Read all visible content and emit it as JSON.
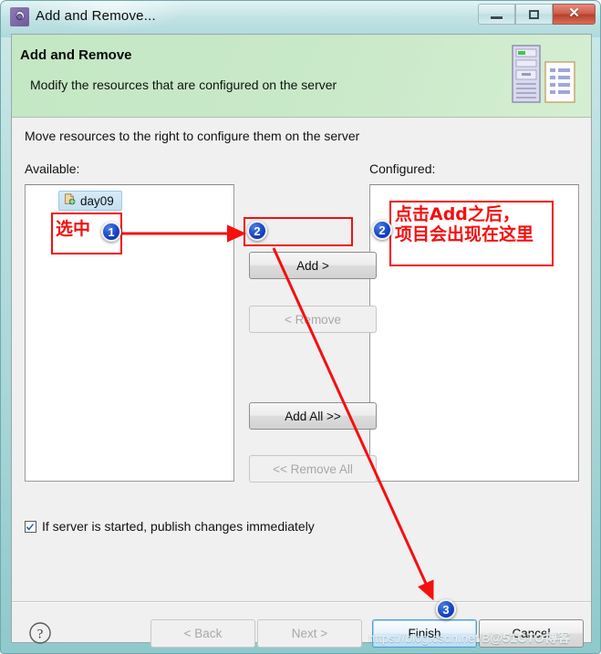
{
  "window": {
    "title": "Add and Remove...",
    "icon": "gear-icon",
    "controls": {
      "minimize": "Minimize",
      "maximize": "Maximize",
      "close": "Close"
    }
  },
  "banner": {
    "title": "Add and Remove",
    "subtitle": "Modify the resources that are configured on the server",
    "artwork": "server-and-document-icon"
  },
  "body": {
    "instruction": "Move resources to the right to configure them on the server",
    "available_label": "Available:",
    "configured_label": "Configured:",
    "available_items": [
      {
        "label": "day09",
        "icon": "web-project-icon",
        "selected": true
      }
    ],
    "configured_items": []
  },
  "transfer_buttons": [
    {
      "label": "Add >",
      "enabled": true
    },
    {
      "label": "< Remove",
      "enabled": false
    },
    {
      "label": "Add All >>",
      "enabled": true
    },
    {
      "label": "<< Remove All",
      "enabled": false
    }
  ],
  "checkbox": {
    "label": "If server is started, publish changes immediately",
    "checked": true
  },
  "footer": {
    "help": "?",
    "back": "< Back",
    "next": "Next >",
    "finish": "Finish",
    "cancel": "Cancel"
  },
  "annotations": {
    "step1_text": "选中",
    "step1_badge": "1",
    "step2_badge": "2",
    "step2b_badge": "2",
    "step3_badge": "3",
    "configured_note_line1": "点击Add之后，",
    "configured_note_line2": "项目会出现在这里",
    "color": "#f50f0f",
    "badge_color": "#1446c8"
  },
  "watermark": {
    "url": "https://blog.csdn.net/B",
    "site": "@51CTO博客"
  }
}
